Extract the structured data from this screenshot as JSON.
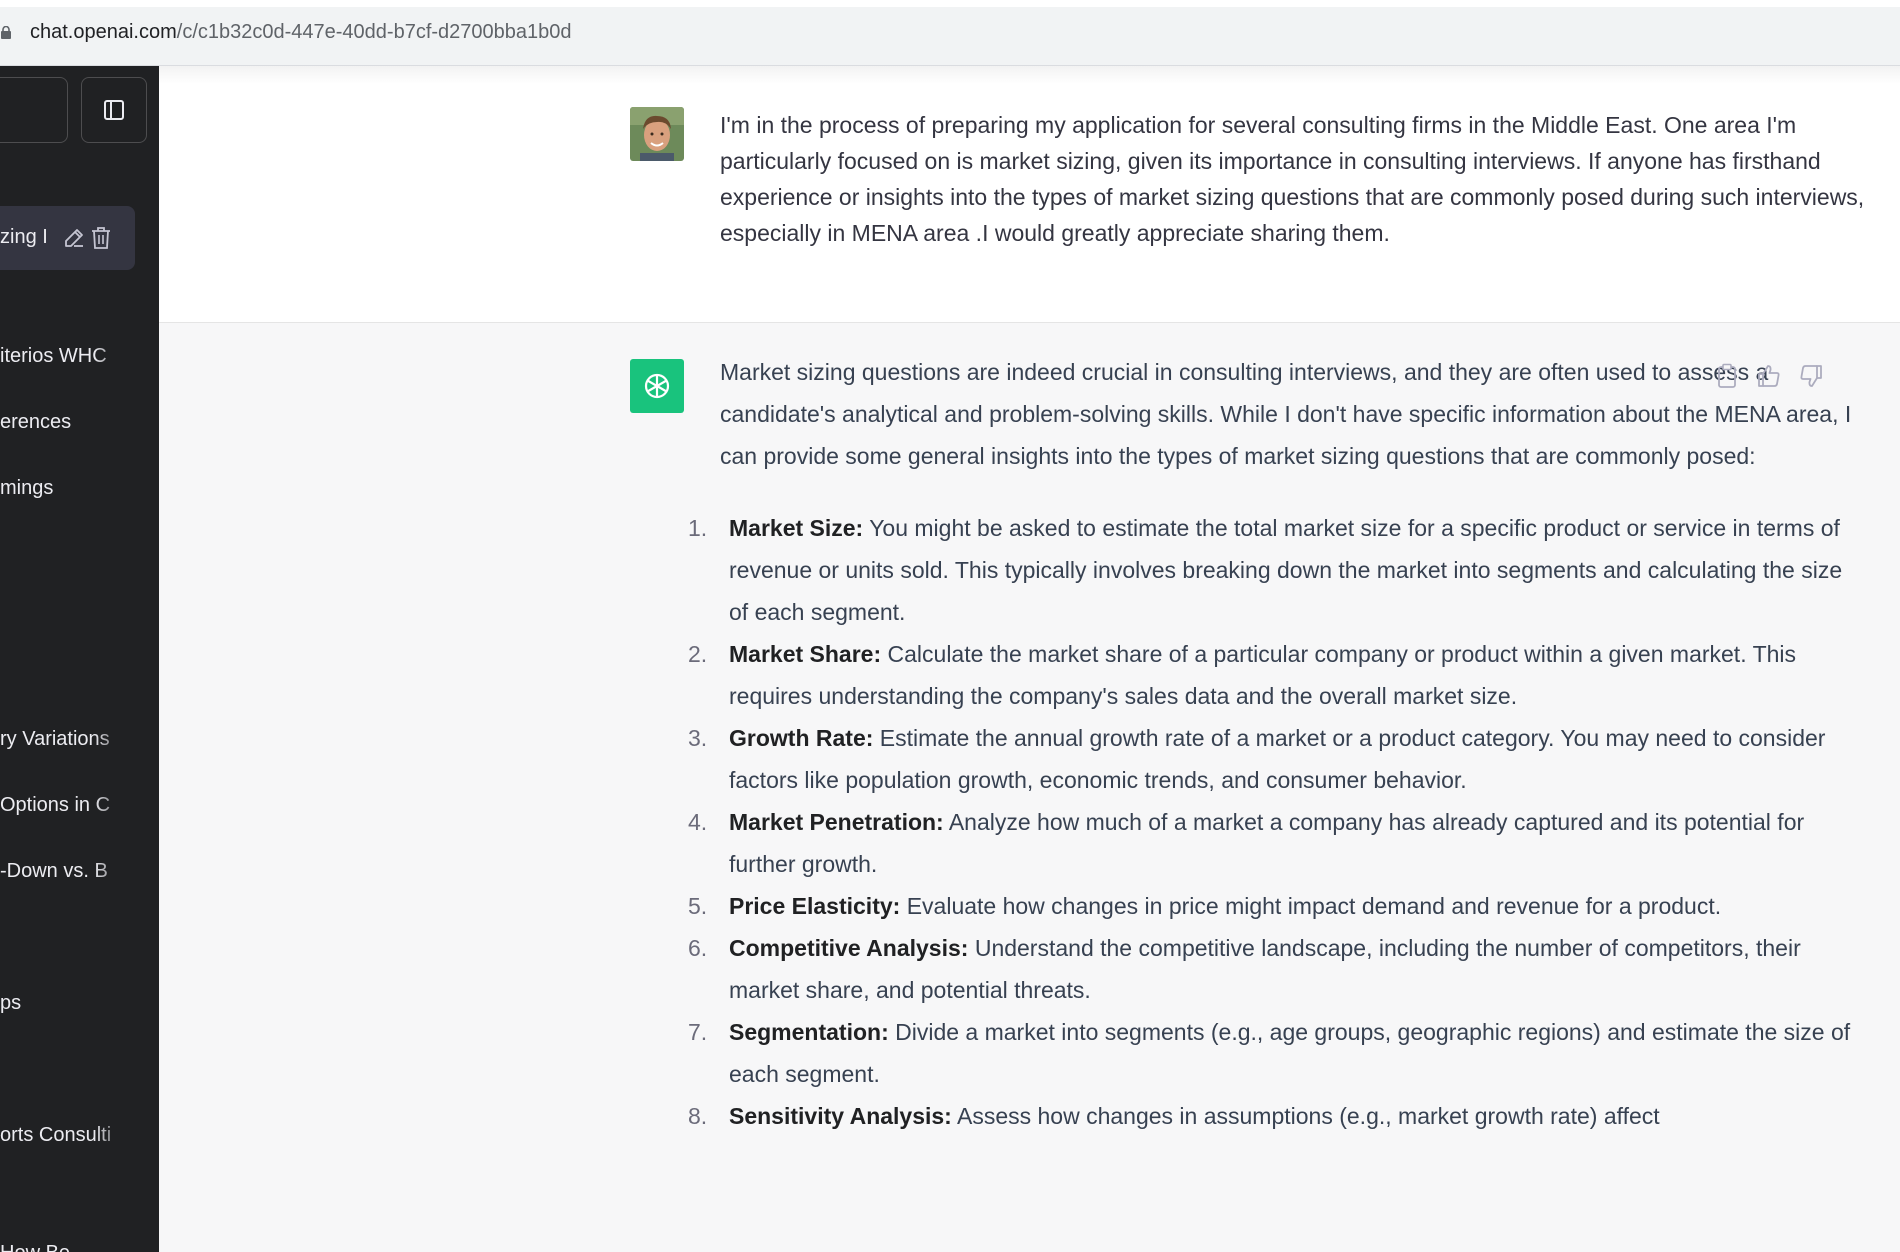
{
  "browser": {
    "url_host": "chat.openai.com",
    "url_path": "/c/c1b32c0d-447e-40dd-b7cf-d2700bba1b0d"
  },
  "sidebar": {
    "active_chat": "zing I",
    "items": [
      {
        "label": "iterios WHC"
      },
      {
        "label": "erences"
      },
      {
        "label": "mings"
      },
      {
        "label": "ry Variations"
      },
      {
        "label": "Options in C"
      },
      {
        "label": "-Down vs. B"
      },
      {
        "label": "ps"
      },
      {
        "label": "orts Consulti"
      },
      {
        "label": "How Be"
      }
    ],
    "icons": {
      "toggle": "sidebar-toggle-icon",
      "edit": "pencil-icon",
      "delete": "trash-icon"
    }
  },
  "conversation": {
    "user_message": "I'm in the process of preparing my application for several consulting firms in the Middle East. One area I'm particularly focused on is market sizing, given its importance in consulting interviews. If anyone has firsthand experience or insights into the types of market sizing questions that are commonly posed during such interviews, especially in MENA area .I would greatly appreciate sharing them.",
    "assistant_intro": "Market sizing questions are indeed crucial in consulting interviews, and they are often used to assess a candidate's analytical and problem-solving skills. While I don't have specific information about the MENA area, I can provide some general insights into the types of market sizing questions that are commonly posed:",
    "list": [
      {
        "num": "1.",
        "title": "Market Size:",
        "text": " You might be asked to estimate the total market size for a specific product or service in terms of revenue or units sold. This typically involves breaking down the market into segments and calculating the size of each segment."
      },
      {
        "num": "2.",
        "title": "Market Share:",
        "text": " Calculate the market share of a particular company or product within a given market. This requires understanding the company's sales data and the overall market size."
      },
      {
        "num": "3.",
        "title": "Growth Rate:",
        "text": " Estimate the annual growth rate of a market or a product category. You may need to consider factors like population growth, economic trends, and consumer behavior."
      },
      {
        "num": "4.",
        "title": "Market Penetration:",
        "text": " Analyze how much of a market a company has already captured and its potential for further growth."
      },
      {
        "num": "5.",
        "title": "Price Elasticity:",
        "text": " Evaluate how changes in price might impact demand and revenue for a product."
      },
      {
        "num": "6.",
        "title": "Competitive Analysis:",
        "text": " Understand the competitive landscape, including the number of competitors, their market share, and potential threats."
      },
      {
        "num": "7.",
        "title": "Segmentation:",
        "text": " Divide a market into segments (e.g., age groups, geographic regions) and estimate the size of each segment."
      },
      {
        "num": "8.",
        "title": "Sensitivity Analysis:",
        "text": " Assess how changes in assumptions (e.g., market growth rate) affect"
      }
    ],
    "message_actions": [
      "copy-icon",
      "thumbs-up-icon",
      "thumbs-down-icon"
    ]
  },
  "colors": {
    "sidebar_bg": "#202123",
    "assistant_bg": "#f7f7f8",
    "gpt_accent": "#19c37d"
  }
}
